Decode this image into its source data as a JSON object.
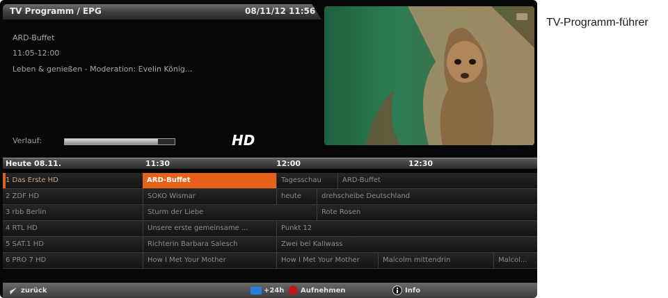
{
  "header": {
    "title": "TV Programm / EPG",
    "datetime": "08/11/12 11:56"
  },
  "current_program": {
    "title": "ARD-Buffet",
    "time": "11:05-12:00",
    "description": "Leben & genießen - Moderation: Evelin König...",
    "progress_label": "Verlauf:",
    "progress": 0.85,
    "badge": "HD"
  },
  "timeline": {
    "day": "Heute 08.11.",
    "slots": [
      "11:30",
      "12:00",
      "12:30"
    ]
  },
  "channels": [
    {
      "name": "1 Das Erste HD",
      "programs": [
        "ARD-Buffet",
        "Tagesschau",
        "ARD-Buffet"
      ]
    },
    {
      "name": "2 ZDF HD",
      "programs": [
        "SOKO Wismar",
        "heute",
        "drehscheibe Deutschland"
      ]
    },
    {
      "name": "3 rbb Berlin",
      "programs": [
        "Sturm der Liebe",
        "Rote Rosen"
      ]
    },
    {
      "name": "4 RTL HD",
      "programs": [
        "Unsere erste gemeinsame ...",
        "Punkt 12"
      ]
    },
    {
      "name": "5 SAT.1 HD",
      "programs": [
        "Richterin Barbara Salesch",
        "Zwei bei Kallwass"
      ]
    },
    {
      "name": "6 PRO 7 HD",
      "programs": [
        "How I Met Your Mother",
        "How I Met Your Mother",
        "Malcolm mittendrin",
        "Malcol..."
      ]
    }
  ],
  "footer": {
    "back": "zurück",
    "plus24": "+24h",
    "record": "Aufnehmen",
    "info": "Info"
  },
  "caption": "TV-Programm-führer",
  "colors": {
    "accent": "#e8611a",
    "background": "#070707",
    "record": "#c0151a",
    "plus24": "#2a7fd6"
  }
}
